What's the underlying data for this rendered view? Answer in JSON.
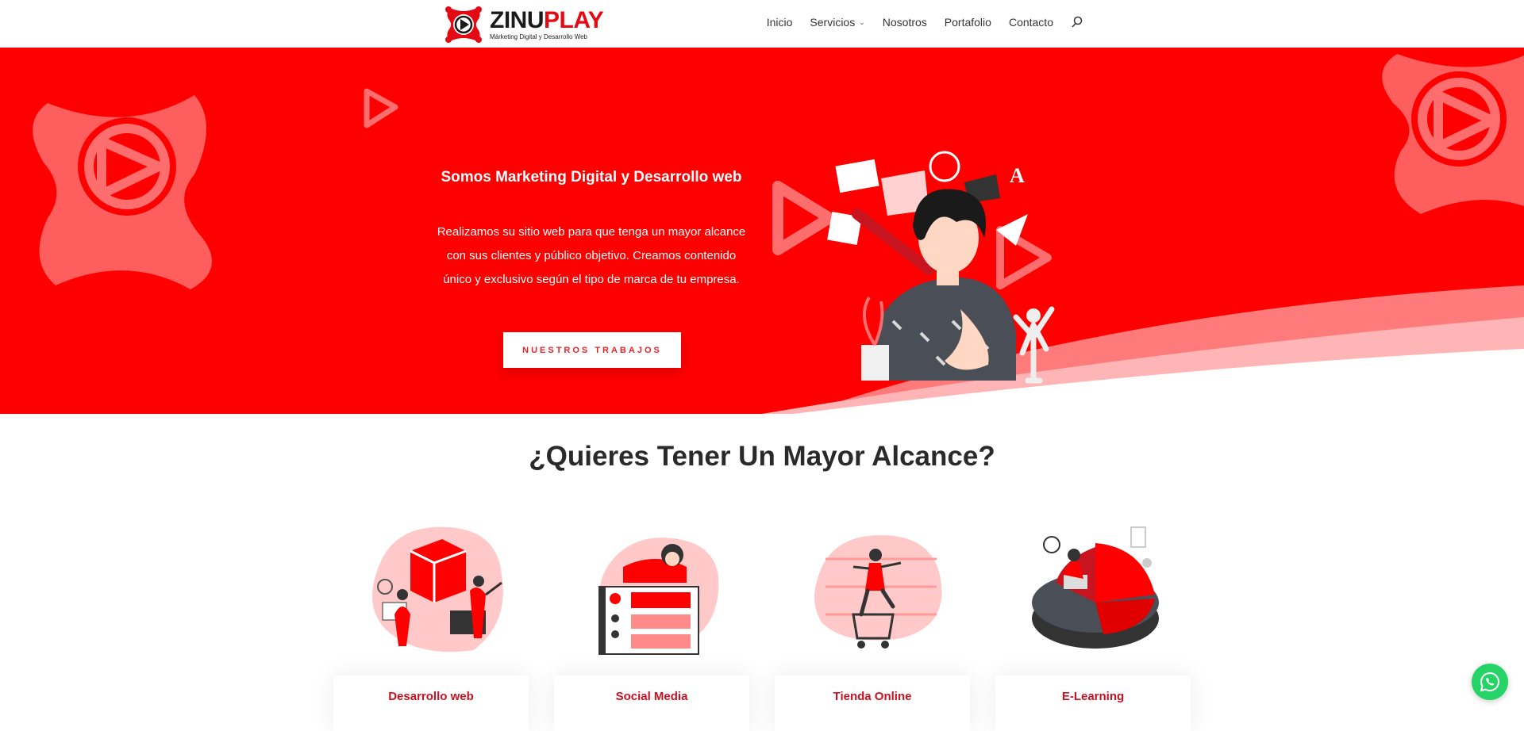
{
  "brand": {
    "name_part1": "ZINU",
    "name_part2": "PLAY",
    "tagline": "Márketing Digital y Desarrollo Web",
    "accent_color": "#fe0000"
  },
  "nav": {
    "items": [
      {
        "label": "Inicio"
      },
      {
        "label": "Servicios",
        "has_dropdown": true
      },
      {
        "label": "Nosotros"
      },
      {
        "label": "Portafolio"
      },
      {
        "label": "Contacto"
      }
    ],
    "search_icon": "search-icon"
  },
  "hero": {
    "title": "Somos Marketing Digital y Desarrollo web",
    "text": "Realizamos  su sitio web para que tenga un mayor alcance con sus clientes y público objetivo. Creamos contenido único y exclusivo según el tipo de marca de tu empresa.",
    "button_label": "NUESTROS TRABAJOS"
  },
  "section": {
    "title": "¿Quieres Tener Un Mayor Alcance?",
    "cards": [
      {
        "label": "Desarrollo web",
        "icon": "web-development-illustration"
      },
      {
        "label": "Social Media",
        "icon": "social-media-illustration"
      },
      {
        "label": "Tienda Online",
        "icon": "online-store-illustration"
      },
      {
        "label": "E-Learning",
        "icon": "e-learning-illustration"
      }
    ]
  },
  "floating": {
    "whatsapp_icon": "whatsapp-icon",
    "whatsapp_color": "#25d366"
  }
}
